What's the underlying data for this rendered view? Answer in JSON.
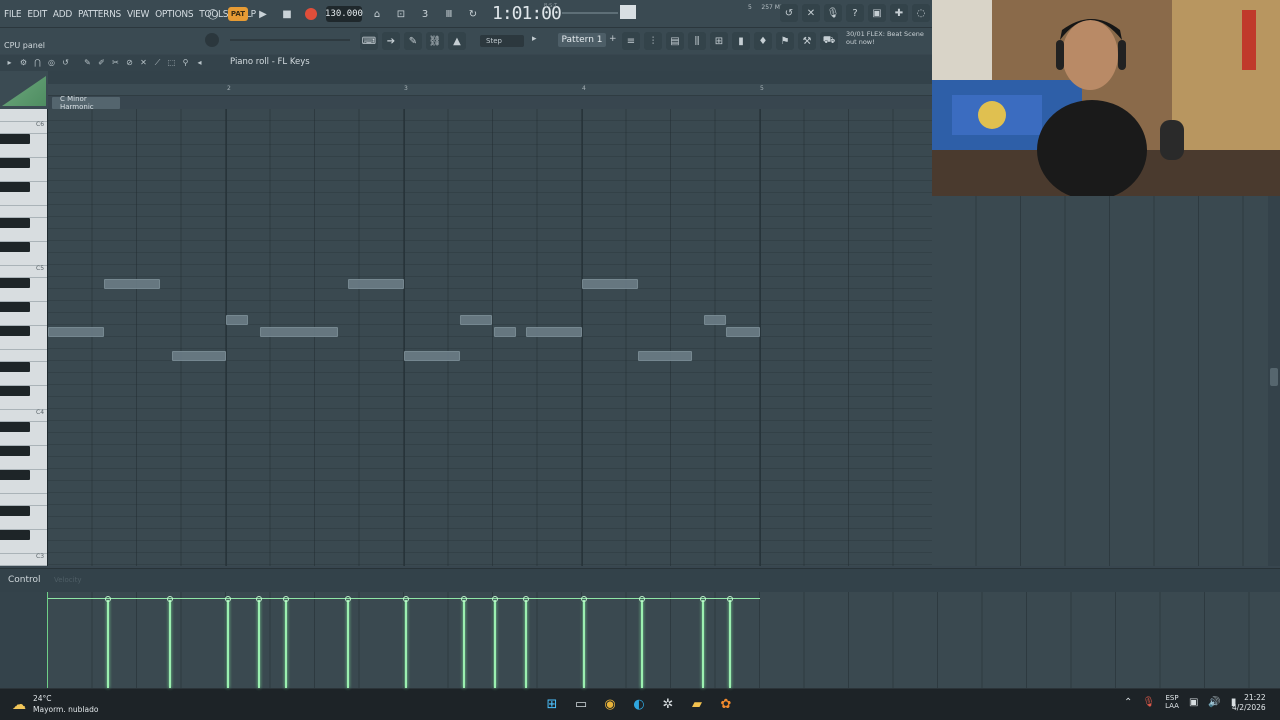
{
  "menu": [
    "FILE",
    "EDIT",
    "ADD",
    "PATTERNS",
    "VIEW",
    "OPTIONS",
    "TOOLS",
    "HELP"
  ],
  "transport": {
    "pat_label": "PAT",
    "tempo": "130.000",
    "song_position": "1:01:00",
    "bst_label": "B:S:T",
    "memory": "257 MB",
    "voices": "5"
  },
  "toolbar2": {
    "cpu_label": "CPU panel",
    "step_label": "Step",
    "pattern": "Pattern 1",
    "news_line1": "30/01  FLEX: Beat Scene",
    "news_line2": "out now!"
  },
  "piano_roll": {
    "title": "Piano roll - FL Keys",
    "scale": "C Minor Harmonic",
    "bars": [
      "2",
      "3",
      "4",
      "5"
    ],
    "octaves": [
      "C6",
      "C5",
      "C4",
      "C3"
    ]
  },
  "control": {
    "label": "Control",
    "sub": "Velocity"
  },
  "taskbar": {
    "temperature": "24°C",
    "weather": "Mayorm. nublado",
    "lang_line1": "ESP",
    "lang_line2": "LAA",
    "time": "21:22",
    "date": "4/2/2026"
  },
  "colors": {
    "accent_orange": "#e69b34",
    "record_red": "#e04e3a",
    "velocity_green": "#9bf0b0"
  }
}
